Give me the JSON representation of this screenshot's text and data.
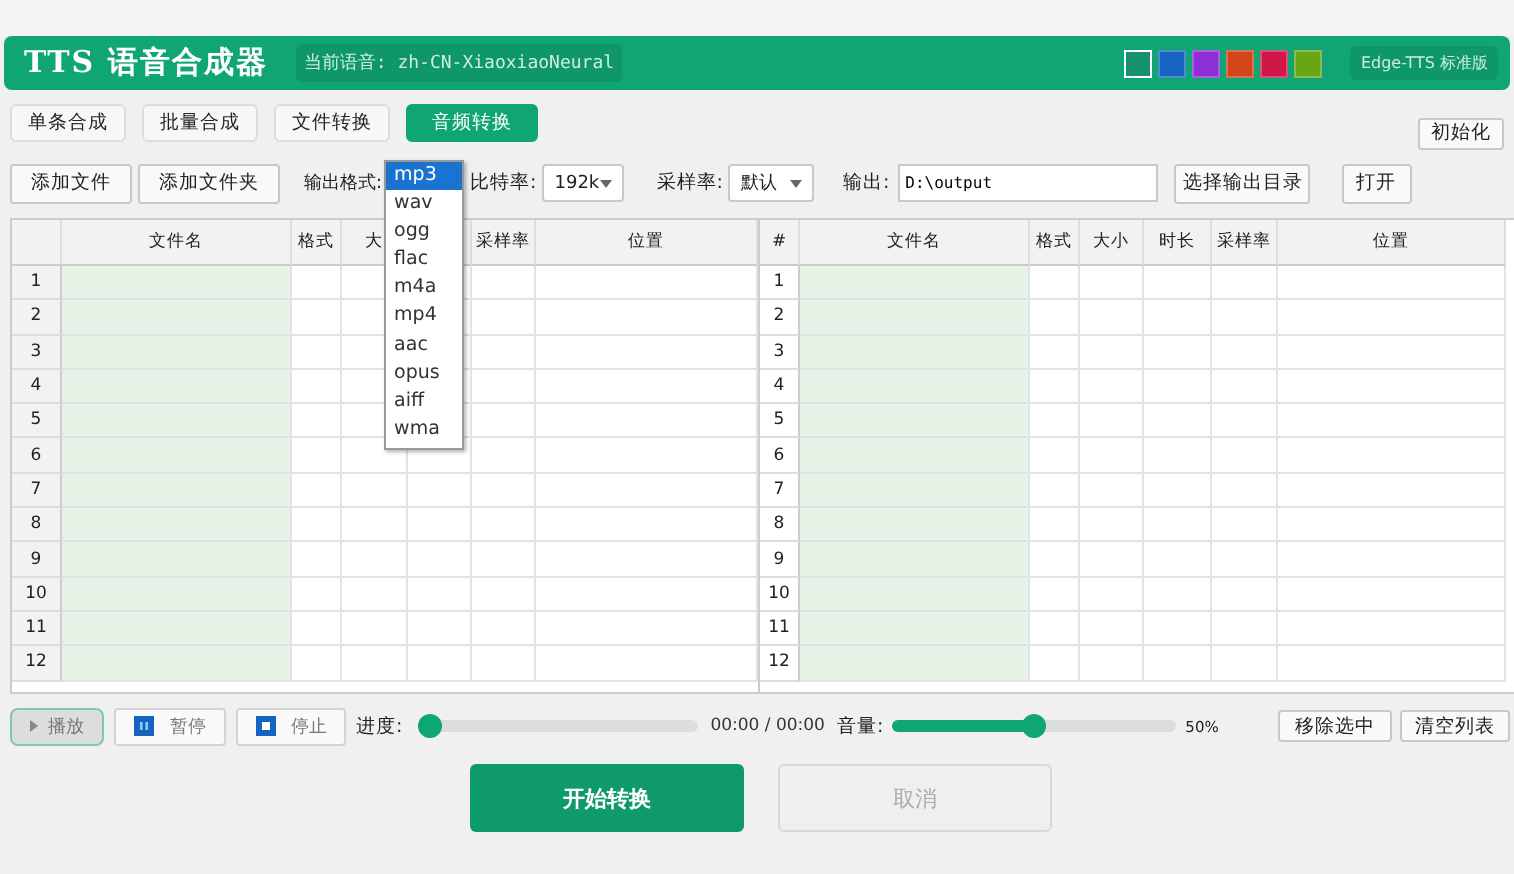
{
  "header": {
    "title": "TTS 语音合成器",
    "voice": "当前语音: zh-CN-XiaoxiaoNeural",
    "themes": [
      {
        "color": "#17916b",
        "selected": true
      },
      {
        "color": "#1565c0",
        "selected": false
      },
      {
        "color": "#8e2ed6",
        "selected": false
      },
      {
        "color": "#d2451a",
        "selected": false
      },
      {
        "color": "#d1174a",
        "selected": false
      },
      {
        "color": "#6aa516",
        "selected": false
      }
    ],
    "badge": "Edge-TTS 标准版"
  },
  "tabs": [
    {
      "label": "单条合成",
      "selected": false
    },
    {
      "label": "批量合成",
      "selected": false
    },
    {
      "label": "文件转换",
      "selected": false
    },
    {
      "label": "音频转换",
      "selected": true
    }
  ],
  "reset_button": "初始化",
  "toolbar": {
    "add_file": "添加文件",
    "add_folder": "添加文件夹",
    "format_label": "输出格式:",
    "bitrate_label": "比特率:",
    "bitrate": "192k",
    "samplerate_label": "采样率:",
    "samplerate": "默认",
    "output_label": "输出:",
    "output_path": "D:\\output",
    "choose_dir": "选择输出目录",
    "open": "打开"
  },
  "format_menu": [
    {
      "label": "mp3",
      "selected": true
    },
    {
      "label": "wav",
      "selected": false
    },
    {
      "label": "ogg",
      "selected": false
    },
    {
      "label": "flac",
      "selected": false
    },
    {
      "label": "m4a",
      "selected": false
    },
    {
      "label": "mp4",
      "selected": false
    },
    {
      "label": "aac",
      "selected": false
    },
    {
      "label": "opus",
      "selected": false
    },
    {
      "label": "aiff",
      "selected": false
    },
    {
      "label": "wma",
      "selected": false
    }
  ],
  "left_table": {
    "columns": [
      {
        "label": "文件名"
      },
      {
        "label": "格式"
      },
      {
        "label": "大"
      },
      {},
      {
        "label": "采样率"
      },
      {
        "label": "位置"
      }
    ],
    "rows": [
      "1",
      "2",
      "3",
      "4",
      "5",
      "6",
      "7",
      "8",
      "9",
      "10",
      "11",
      "12"
    ]
  },
  "right_table": {
    "corner": "#",
    "columns": [
      {
        "label": "文件名"
      },
      {
        "label": "格式"
      },
      {
        "label": "大小"
      },
      {
        "label": "时长"
      },
      {
        "label": "采样率"
      },
      {
        "label": "位置"
      }
    ],
    "rows": [
      "1",
      "2",
      "3",
      "4",
      "5",
      "6",
      "7",
      "8",
      "9",
      "10",
      "11",
      "12"
    ]
  },
  "player": {
    "play": "播放",
    "pause": "暂停",
    "stop": "停止",
    "progress_label": "进度:",
    "progress": {
      "level": 0
    },
    "time": "00:00 / 00:00",
    "volume_label": "音量:",
    "volume": {
      "level": 0.5
    },
    "volume_reading": "50%",
    "remove_selected": "移除选中",
    "clear_list": "清空列表"
  },
  "actions": [
    {
      "label": "开始转换",
      "disabled": false
    },
    {
      "label": "取消",
      "disabled": true
    }
  ]
}
